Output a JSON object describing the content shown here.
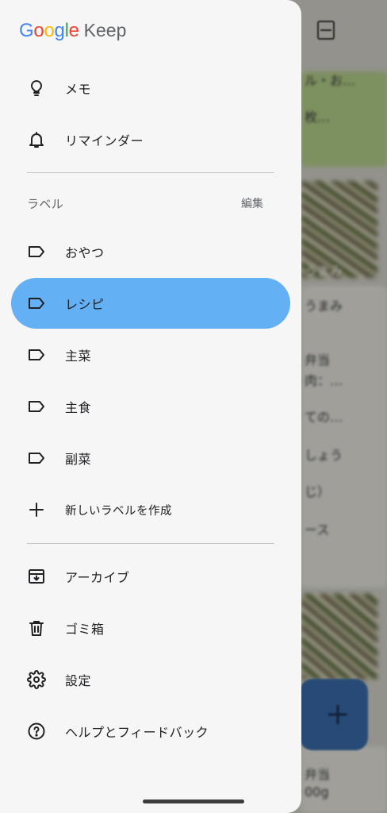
{
  "app": {
    "logo_google": [
      "G",
      "o",
      "o",
      "g",
      "l",
      "e"
    ],
    "logo_product": "Keep"
  },
  "drawer": {
    "primary": [
      {
        "label": "メモ",
        "icon": "lightbulb-icon"
      },
      {
        "label": "リマインダー",
        "icon": "bell-icon"
      }
    ],
    "labels_section": {
      "title": "ラベル",
      "edit_label": "編集"
    },
    "labels": [
      {
        "label": "おやつ",
        "icon": "label-icon",
        "active": false
      },
      {
        "label": "レシピ",
        "icon": "label-icon",
        "active": true
      },
      {
        "label": "主菜",
        "icon": "label-icon",
        "active": false
      },
      {
        "label": "主食",
        "icon": "label-icon",
        "active": false
      },
      {
        "label": "副菜",
        "icon": "label-icon",
        "active": false
      }
    ],
    "create_label": {
      "label": "新しいラベルを作成",
      "icon": "plus-icon"
    },
    "secondary": [
      {
        "label": "アーカイブ",
        "icon": "archive-icon"
      },
      {
        "label": "ゴミ箱",
        "icon": "trash-icon"
      },
      {
        "label": "設定",
        "icon": "gear-icon"
      },
      {
        "label": "ヘルプとフィードバック",
        "icon": "help-icon"
      }
    ]
  },
  "background": {
    "snippets": [
      "ル・お…",
      "枚…",
      "うまみ",
      "弁当",
      "肉：…",
      "ての…",
      "しょう",
      "じ）",
      "ース",
      "弁当",
      "00g"
    ],
    "fab_icon": "+"
  },
  "colors": {
    "active_item": "#64b0f4",
    "drawer_bg": "#f6f6f6",
    "text": "#202124",
    "muted": "#5f6368"
  }
}
